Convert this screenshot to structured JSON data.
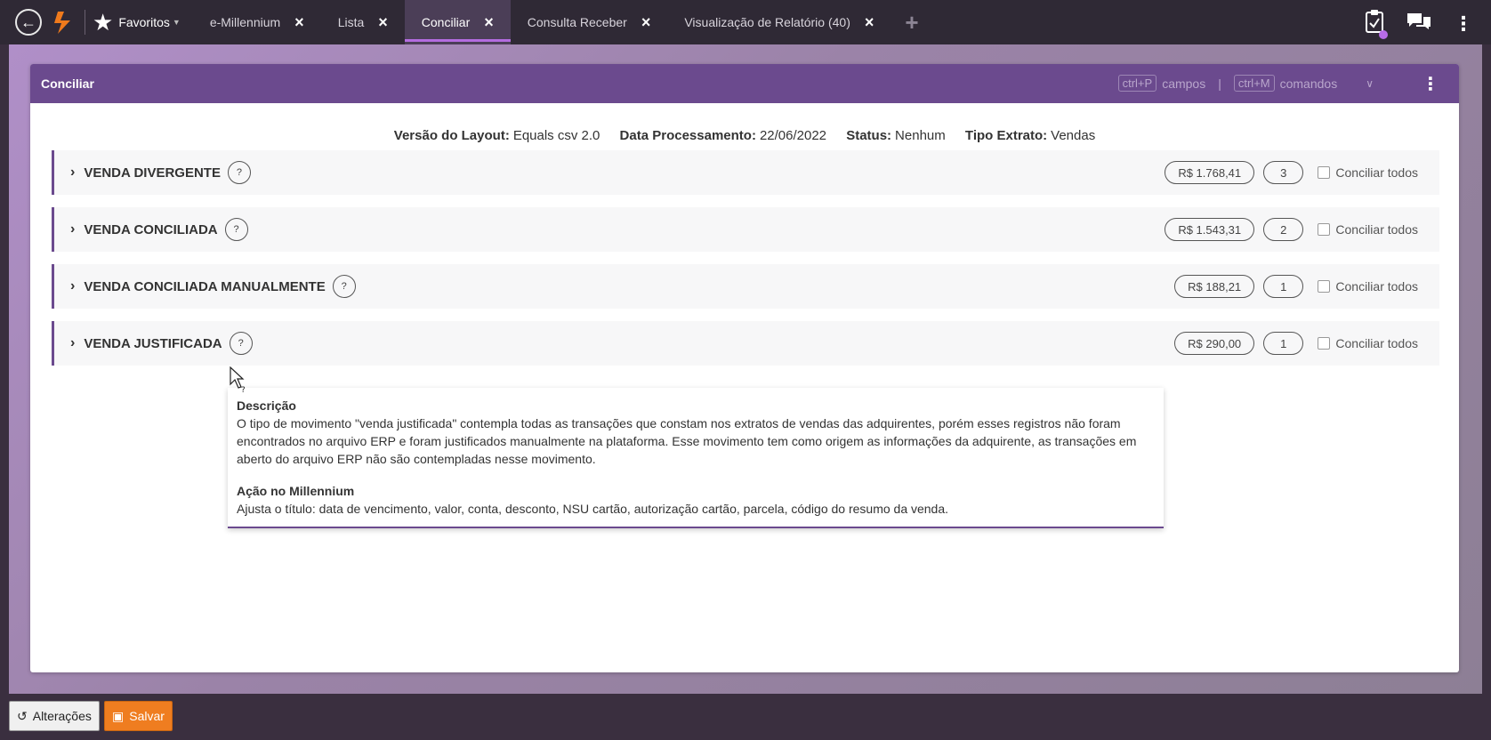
{
  "topbar": {
    "favorites_label": "Favoritos",
    "tabs": [
      {
        "label": "e-Millennium"
      },
      {
        "label": "Lista"
      },
      {
        "label": "Conciliar"
      },
      {
        "label": "Consulta Receber"
      },
      {
        "label": "Visualização de Relatório (40)"
      }
    ],
    "active_tab": "Conciliar"
  },
  "panel": {
    "title": "Conciliar",
    "hint_key1": "ctrl+P",
    "hint_text1": "campos",
    "hint_pipe": "|",
    "hint_key2": "ctrl+M",
    "hint_text2": "comandos"
  },
  "info": {
    "layout_label": "Versão do Layout:",
    "layout_value": "Equals csv 2.0",
    "date_label": "Data Processamento:",
    "date_value": "22/06/2022",
    "status_label": "Status:",
    "status_value": "Nenhum",
    "type_label": "Tipo Extrato:",
    "type_value": "Vendas"
  },
  "sections": [
    {
      "title": "VENDA DIVERGENTE",
      "amount": "R$ 1.768,41",
      "count": "3",
      "check_label": "Conciliar todos"
    },
    {
      "title": "VENDA CONCILIADA",
      "amount": "R$ 1.543,31",
      "count": "2",
      "check_label": "Conciliar todos"
    },
    {
      "title": "VENDA CONCILIADA MANUALMENTE",
      "amount": "R$ 188,21",
      "count": "1",
      "check_label": "Conciliar todos"
    },
    {
      "title": "VENDA JUSTIFICADA",
      "amount": "R$ 290,00",
      "count": "1",
      "check_label": "Conciliar todos"
    }
  ],
  "help_glyph": "?",
  "tooltip": {
    "desc_title": "Descrição",
    "desc_text": "O tipo de movimento \"venda justificada\" contempla todas as transações que constam nos extratos de vendas das adquirentes, porém esses registros não foram encontrados no arquivo ERP e foram justificados manualmente na plataforma. Esse movimento tem como origem as informações da adquirente, as transações em aberto do arquivo ERP não são contempladas nesse movimento.",
    "action_title": "Ação no Millennium",
    "action_text": "Ajusta o título: data de vencimento, valor, conta, desconto, NSU cartão, autorização cartão, parcela, código do resumo da venda."
  },
  "bottombar": {
    "changes_label": "Alterações",
    "save_label": "Salvar"
  },
  "colors": {
    "accent": "#6b4a8e",
    "tab_underline": "#b46ce0",
    "save": "#ef7d20"
  },
  "icons": [
    "back-arrow-icon",
    "logo-icon",
    "star-icon",
    "close-icon",
    "plus-icon",
    "clipboard-icon",
    "chat-icon",
    "more-vert-icon",
    "chevron-right-icon",
    "help-icon",
    "history-icon",
    "save-icon"
  ]
}
